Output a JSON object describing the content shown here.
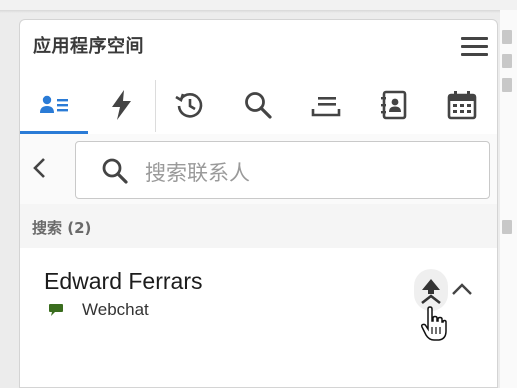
{
  "panel": {
    "title": "应用程序空间"
  },
  "toolbar": {
    "tools": [
      {
        "name": "contacts",
        "icon": "contacts-list-icon",
        "active": true
      },
      {
        "name": "quick-actions",
        "icon": "lightning-icon",
        "active": false
      },
      {
        "name": "history",
        "icon": "history-icon",
        "active": false
      },
      {
        "name": "search",
        "icon": "search-icon",
        "active": false
      },
      {
        "name": "queue",
        "icon": "queue-icon",
        "active": false
      },
      {
        "name": "address-book",
        "icon": "address-book-icon",
        "active": false
      },
      {
        "name": "calendar",
        "icon": "calendar-icon",
        "active": false
      }
    ],
    "active_color": "#2a7bd6"
  },
  "search": {
    "placeholder": "搜索联系人"
  },
  "results": {
    "label": "搜索 (2)"
  },
  "contacts": [
    {
      "name": "Edward Ferrars",
      "channel": "Webchat",
      "channel_color": "#3a6d1e"
    }
  ]
}
